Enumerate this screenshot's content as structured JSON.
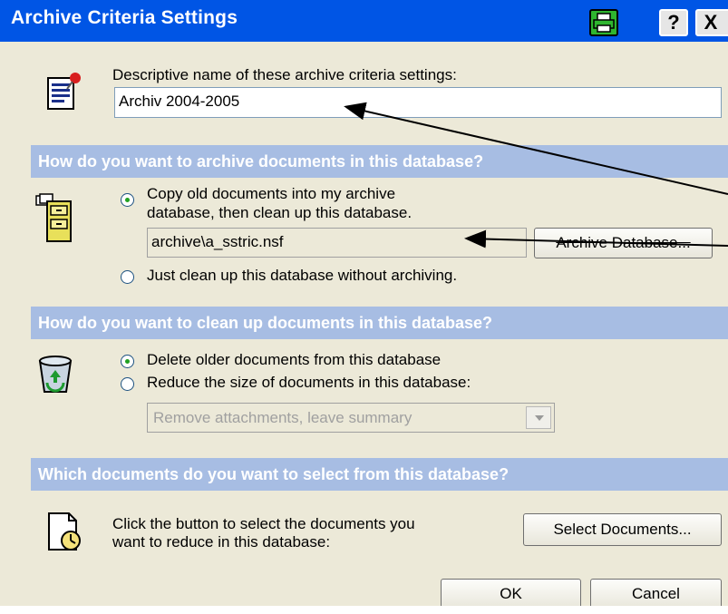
{
  "window": {
    "title": "Archive Criteria Settings",
    "help_glyph": "?",
    "close_glyph": "X"
  },
  "name_section": {
    "label": "Descriptive name of these archive criteria settings:",
    "value": "Archiv 2004-2005"
  },
  "archive_section": {
    "header": "How do you want to archive documents in this database?",
    "option_copy_line1": "Copy old documents into my archive",
    "option_copy_line2": "database, then clean up this database.",
    "archive_db_path": "archive\\a_sstric.nsf",
    "archive_db_button": "Archive Database...",
    "option_cleanup_only": "Just clean up this database without archiving."
  },
  "cleanup_section": {
    "header": "How do you want to clean up documents in this database?",
    "option_delete": "Delete older documents from this database",
    "option_reduce": "Reduce the size of documents in this database:",
    "reduce_select_value": "Remove attachments, leave summary"
  },
  "select_section": {
    "header": "Which documents do you want to select from this database?",
    "instruction_line1": "Click the button to select the documents you",
    "instruction_line2": "want to reduce in this database:",
    "select_button": "Select Documents..."
  },
  "footer": {
    "ok_label": "OK",
    "cancel_label": "Cancel"
  },
  "colors": {
    "titlebar": "#0055e5",
    "section_header": "#a7bde3",
    "dialog_bg": "#ece9d8"
  },
  "icons": [
    "notes-document-icon",
    "filing-cabinet-icon",
    "recycle-bin-icon",
    "document-clock-icon",
    "printer-icon"
  ]
}
